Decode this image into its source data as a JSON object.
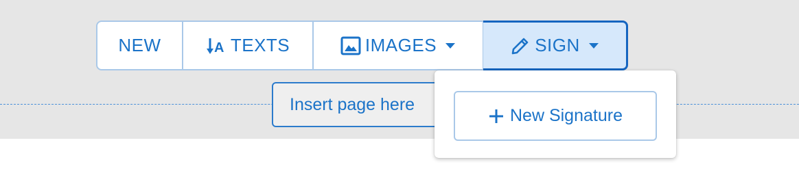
{
  "toolbar": {
    "new_label": "NEW",
    "texts_label": "TEXTS",
    "images_label": "IMAGES",
    "sign_label": "SIGN"
  },
  "insert_page": {
    "label": "Insert page here"
  },
  "sign_menu": {
    "new_signature_label": "New Signature"
  },
  "colors": {
    "accent": "#1b73c8",
    "active_border": "#1565c0",
    "active_bg": "#d6e8fb",
    "page_bg": "#e6e6e6"
  },
  "icons": {
    "texts": "text-direction-icon",
    "images": "image-icon",
    "sign": "pencil-icon",
    "add": "plus-icon",
    "caret": "caret-down-icon"
  }
}
